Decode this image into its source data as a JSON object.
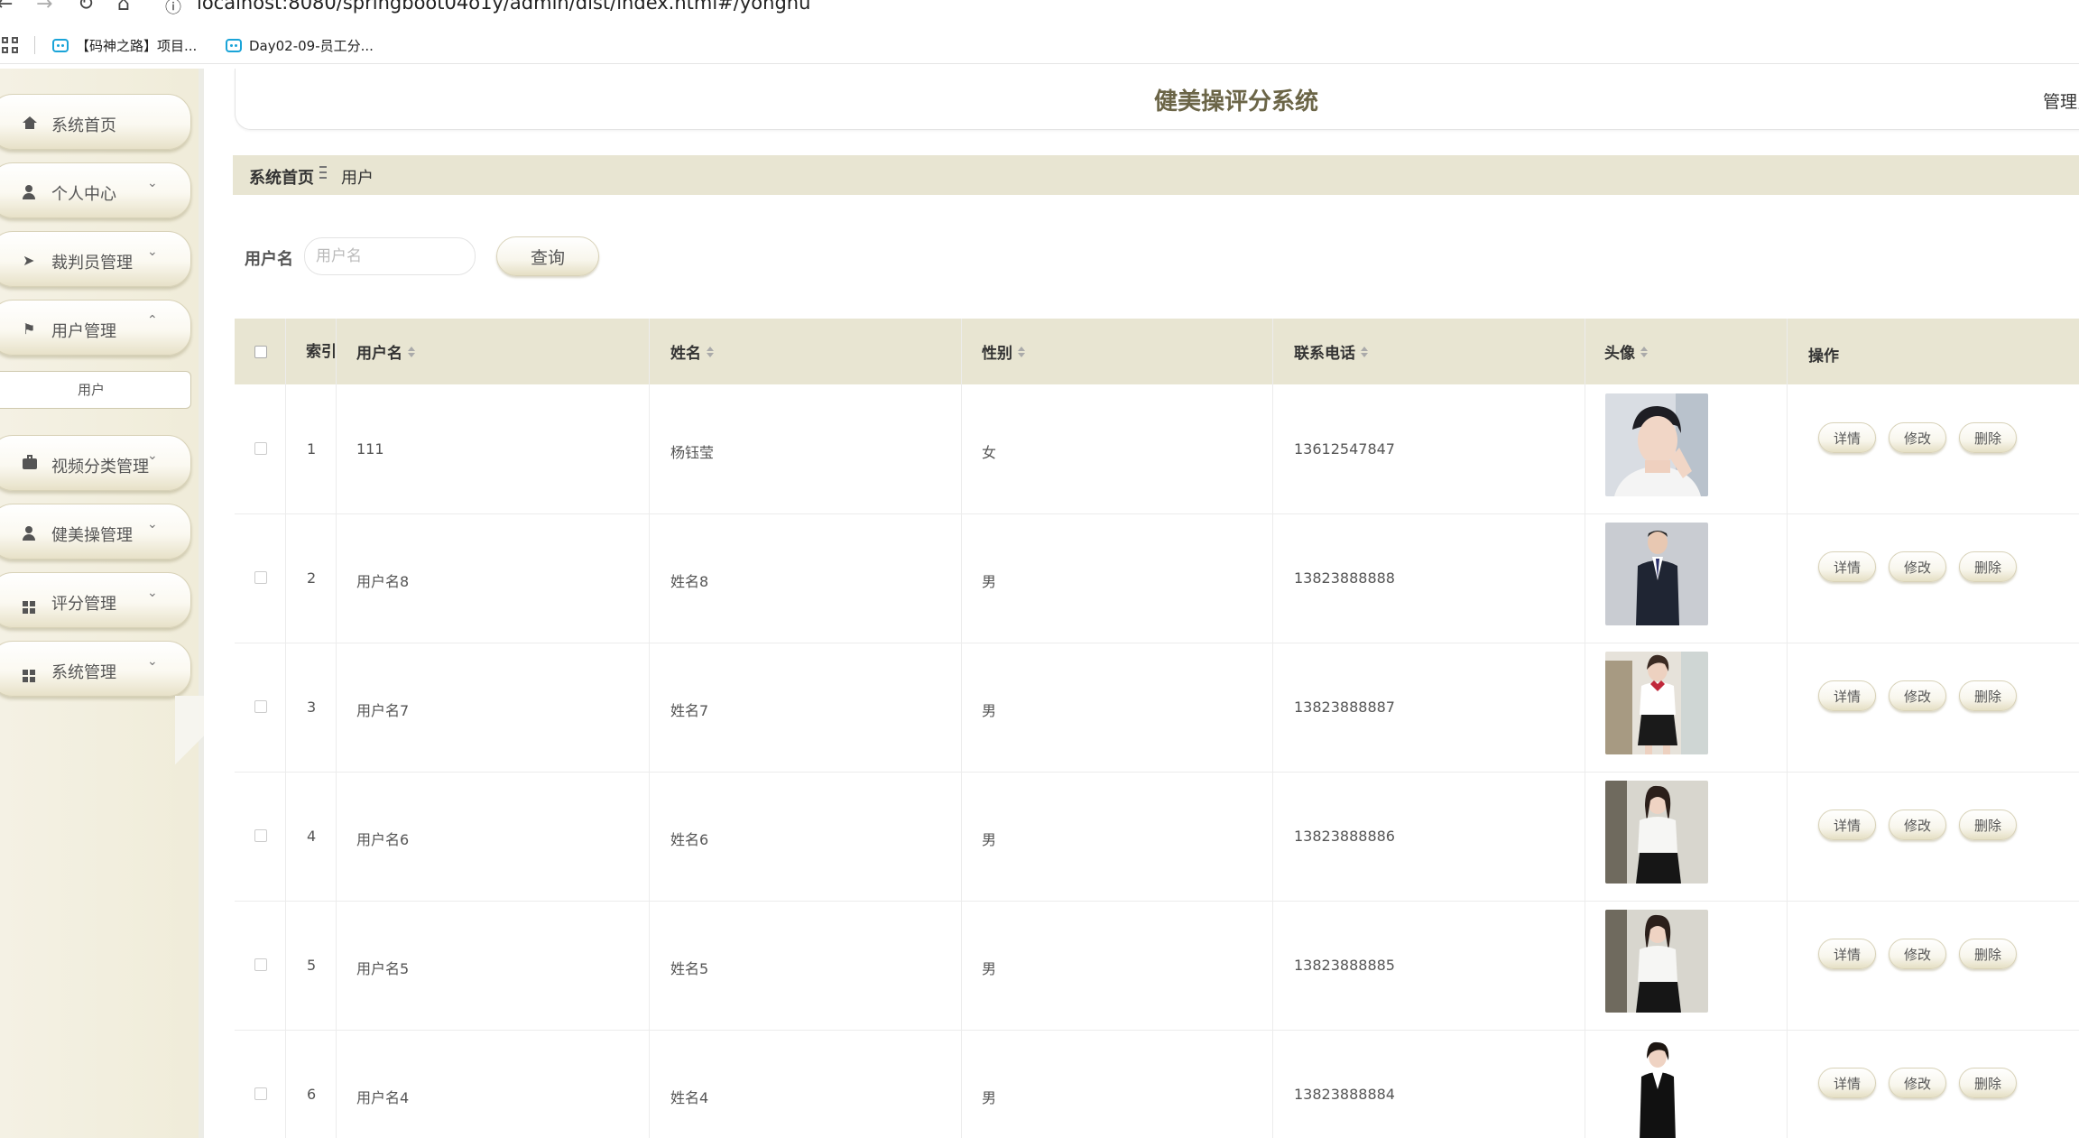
{
  "browser": {
    "url": "localhost:8080/springboot04o1y/admin/dist/index.html#/yonghu",
    "bookmarks": [
      {
        "label": "【码神之路】项目..."
      },
      {
        "label": "Day02-09-员工分..."
      }
    ]
  },
  "header": {
    "title": "健美操评分系统",
    "admin_label": "管理员"
  },
  "sidebar": {
    "items": [
      {
        "label": "系统首页",
        "icon": "home-icon",
        "chevron": ""
      },
      {
        "label": "个人中心",
        "icon": "user-icon",
        "chevron": "⌄"
      },
      {
        "label": "裁判员管理",
        "icon": "paper-plane-icon",
        "chevron": "⌄"
      },
      {
        "label": "用户管理",
        "icon": "flag-icon",
        "chevron": "⌃"
      },
      {
        "label": "视频分类管理",
        "icon": "briefcase-icon",
        "chevron": "⌄"
      },
      {
        "label": "健美操管理",
        "icon": "user-icon",
        "chevron": "⌄"
      },
      {
        "label": "评分管理",
        "icon": "grid-icon",
        "chevron": "⌄"
      },
      {
        "label": "系统管理",
        "icon": "grid-icon",
        "chevron": "⌄"
      }
    ],
    "submenu_active": "用户"
  },
  "breadcrumb": {
    "home": "系统首页",
    "current": "用户"
  },
  "search": {
    "label": "用户名",
    "placeholder": "用户名",
    "button": "查询"
  },
  "table": {
    "headers": {
      "index": "索引",
      "username": "用户名",
      "name": "姓名",
      "gender": "性别",
      "phone": "联系电话",
      "avatar": "头像",
      "actions": "操作"
    },
    "action_labels": {
      "detail": "详情",
      "edit": "修改",
      "delete": "删除"
    },
    "rows": [
      {
        "index": "1",
        "username": "111",
        "name": "杨钰莹",
        "gender": "女",
        "phone": "13612547847"
      },
      {
        "index": "2",
        "username": "用户名8",
        "name": "姓名8",
        "gender": "男",
        "phone": "13823888888"
      },
      {
        "index": "3",
        "username": "用户名7",
        "name": "姓名7",
        "gender": "男",
        "phone": "13823888887"
      },
      {
        "index": "4",
        "username": "用户名6",
        "name": "姓名6",
        "gender": "男",
        "phone": "13823888886"
      },
      {
        "index": "5",
        "username": "用户名5",
        "name": "姓名5",
        "gender": "男",
        "phone": "13823888885"
      },
      {
        "index": "6",
        "username": "用户名4",
        "name": "姓名4",
        "gender": "男",
        "phone": "13823888884"
      }
    ]
  },
  "colors": {
    "accent": "#e8e5d2",
    "title": "#6b6547",
    "sidebar_bg": "#f0ecd9"
  }
}
